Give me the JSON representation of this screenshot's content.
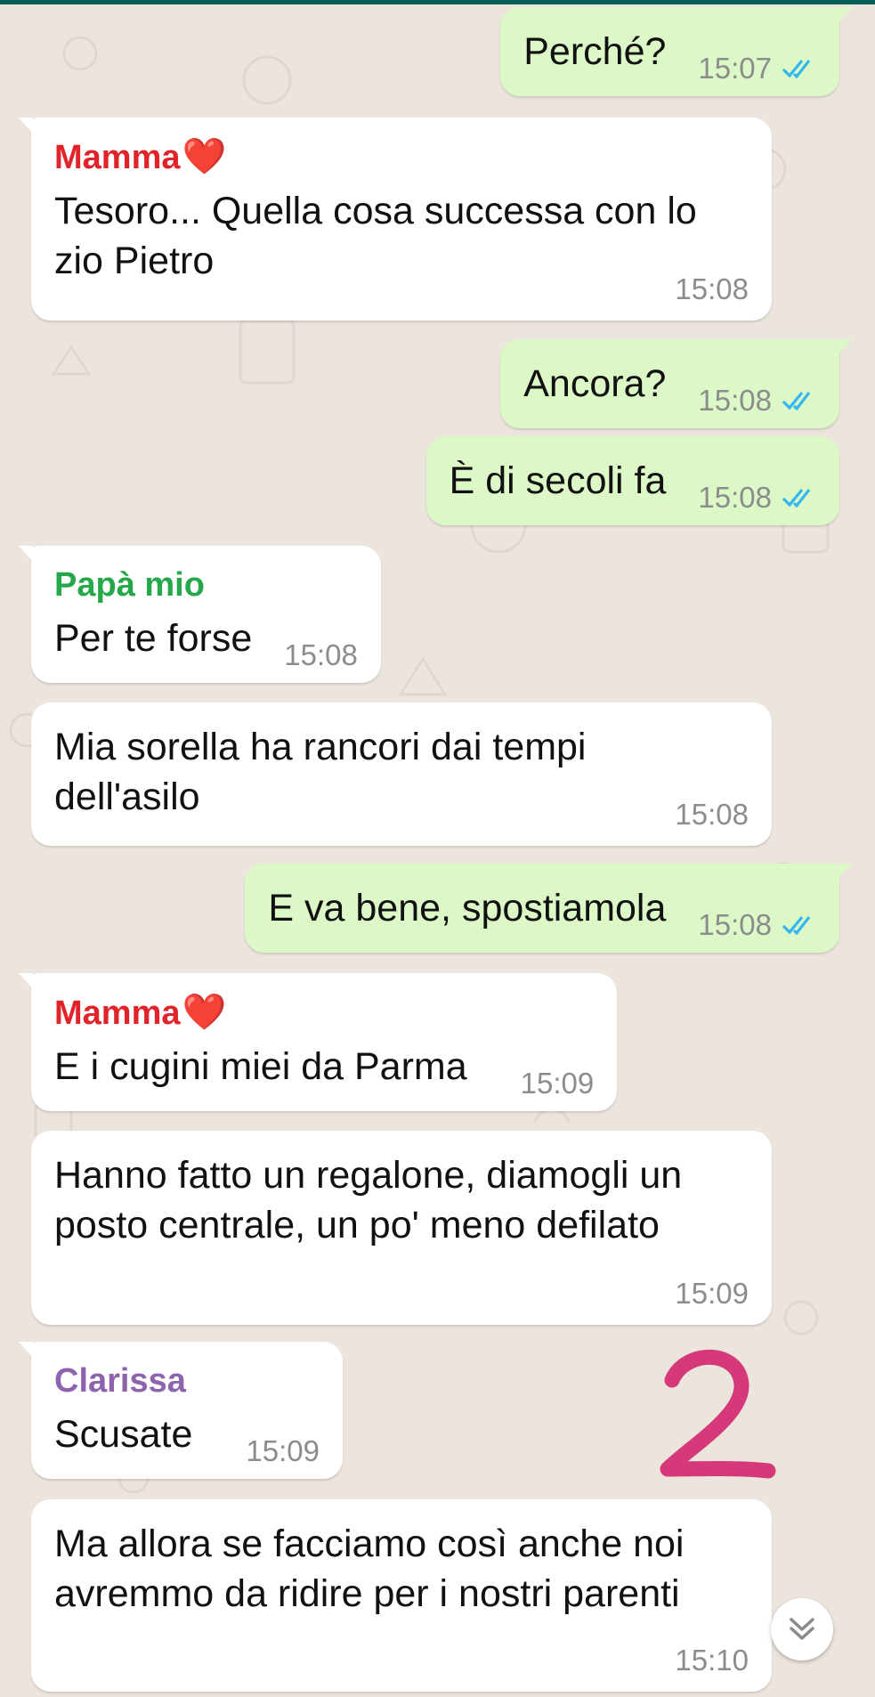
{
  "colors": {
    "incoming": "#ffffff",
    "outgoing": "#dcf8c6",
    "sender_mamma": "#e0242a",
    "sender_papa": "#25a84a",
    "sender_clarissa": "#8e63ae",
    "read_ticks": "#34b7f1",
    "annotation": "#d6397a"
  },
  "messages": [
    {
      "id": "m1",
      "dir": "out",
      "text": "Perché?",
      "time": "15:07",
      "ticks": "read"
    },
    {
      "id": "m2",
      "dir": "in",
      "sender": "Mamma",
      "sender_emoji": "❤️",
      "text": "Tesoro... Quella cosa successa con lo zio Pietro",
      "time": "15:08"
    },
    {
      "id": "m3",
      "dir": "out",
      "text": "Ancora?",
      "time": "15:08",
      "ticks": "read"
    },
    {
      "id": "m4",
      "dir": "out",
      "text": "È di secoli fa",
      "time": "15:08",
      "ticks": "read"
    },
    {
      "id": "m5",
      "dir": "in",
      "sender": "Papà mio",
      "text": "Per te forse",
      "time": "15:08"
    },
    {
      "id": "m6",
      "dir": "in",
      "text": "Mia sorella ha rancori dai tempi dell'asilo",
      "time": "15:08"
    },
    {
      "id": "m7",
      "dir": "out",
      "text": "E va bene, spostiamola",
      "time": "15:08",
      "ticks": "read"
    },
    {
      "id": "m8",
      "dir": "in",
      "sender": "Mamma",
      "sender_emoji": "❤️",
      "text": "E i cugini miei da Parma",
      "time": "15:09"
    },
    {
      "id": "m9",
      "dir": "in",
      "text": "Hanno fatto un regalone, diamogli un posto centrale, un po' meno defilato",
      "time": "15:09"
    },
    {
      "id": "m10",
      "dir": "in",
      "sender": "Clarissa",
      "text": "Scusate",
      "time": "15:09"
    },
    {
      "id": "m11",
      "dir": "in",
      "text": "Ma allora se facciamo così anche noi avremmo da ridire per i nostri parenti",
      "time": "15:10"
    }
  ],
  "annotation": {
    "text": "2"
  },
  "scroll_button": {
    "icon": "double-chevron-down-icon"
  }
}
